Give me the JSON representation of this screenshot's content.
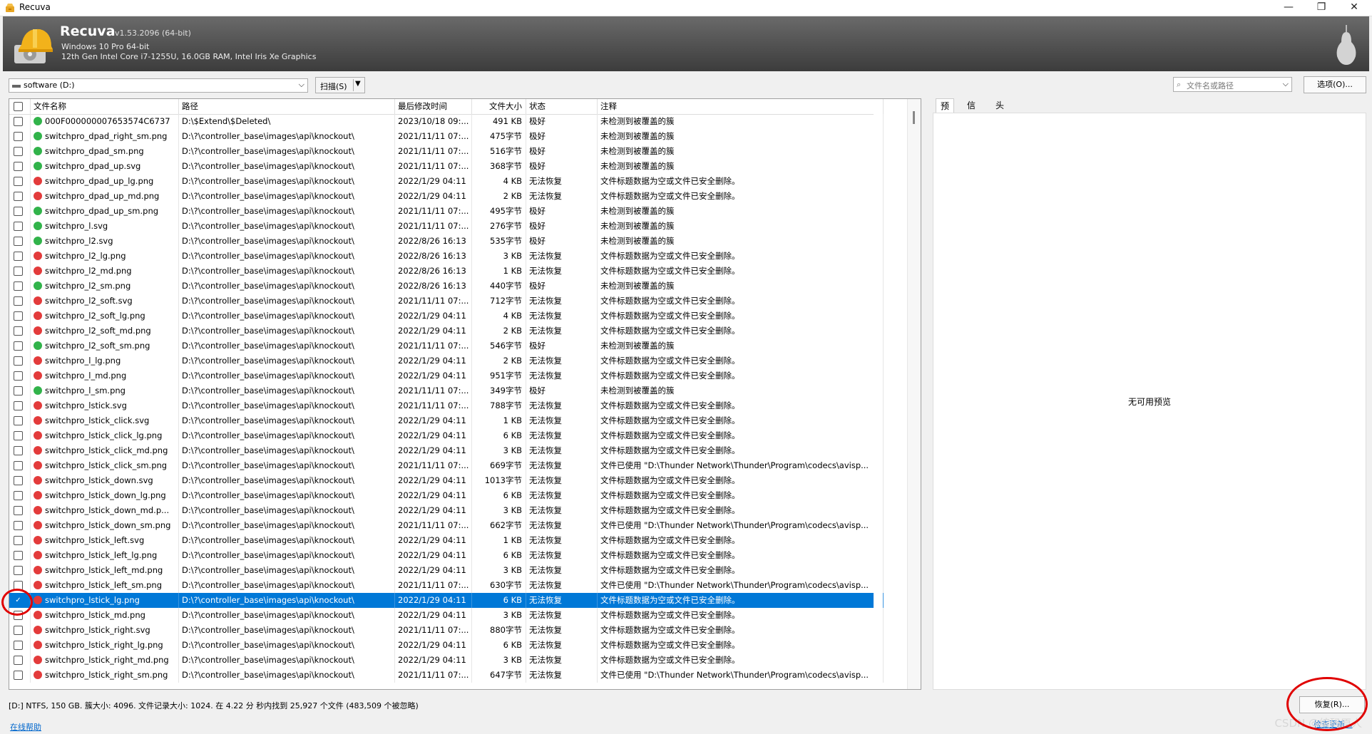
{
  "window": {
    "title": "Recuva",
    "buttons": [
      "—",
      "❐",
      "✕"
    ]
  },
  "header": {
    "app_name": "Recuva",
    "version": "v1.53.2096 (64-bit)",
    "os": "Windows 10 Pro 64-bit",
    "hardware": "12th Gen Intel Core i7-1255U, 16.0GB RAM, Intel Iris Xe Graphics"
  },
  "toolbar": {
    "drive": "software (D:)",
    "scan": "扫描(S)",
    "search_placeholder": "文件名或路径",
    "options": "选项(O)..."
  },
  "colors": {
    "good": "#31b34a",
    "bad": "#e33b3b",
    "selected": "#0078d7",
    "annotation": "#e00000"
  },
  "columns": [
    "文件名称",
    "路径",
    "最后修改时间",
    "文件大小",
    "状态",
    "注释"
  ],
  "rows": [
    {
      "name": "000F000000007653574C6737",
      "path": "D:\\$Extend\\$Deleted\\",
      "mtime": "2023/10/18 09:...",
      "size": "491 KB",
      "state": "极好",
      "note": "未检测到被覆盖的簇",
      "ok": true,
      "checked": false
    },
    {
      "name": "switchpro_dpad_right_sm.png",
      "path": "D:\\?\\controller_base\\images\\api\\knockout\\",
      "mtime": "2021/11/11 07:...",
      "size": "475字节",
      "state": "极好",
      "note": "未检测到被覆盖的簇",
      "ok": true,
      "checked": false
    },
    {
      "name": "switchpro_dpad_sm.png",
      "path": "D:\\?\\controller_base\\images\\api\\knockout\\",
      "mtime": "2021/11/11 07:...",
      "size": "516字节",
      "state": "极好",
      "note": "未检测到被覆盖的簇",
      "ok": true,
      "checked": false
    },
    {
      "name": "switchpro_dpad_up.svg",
      "path": "D:\\?\\controller_base\\images\\api\\knockout\\",
      "mtime": "2021/11/11 07:...",
      "size": "368字节",
      "state": "极好",
      "note": "未检测到被覆盖的簇",
      "ok": true,
      "checked": false
    },
    {
      "name": "switchpro_dpad_up_lg.png",
      "path": "D:\\?\\controller_base\\images\\api\\knockout\\",
      "mtime": "2022/1/29 04:11",
      "size": "4 KB",
      "state": "无法恢复",
      "note": "文件标题数据为空或文件已安全删除。",
      "ok": false,
      "checked": false
    },
    {
      "name": "switchpro_dpad_up_md.png",
      "path": "D:\\?\\controller_base\\images\\api\\knockout\\",
      "mtime": "2022/1/29 04:11",
      "size": "2 KB",
      "state": "无法恢复",
      "note": "文件标题数据为空或文件已安全删除。",
      "ok": false,
      "checked": false
    },
    {
      "name": "switchpro_dpad_up_sm.png",
      "path": "D:\\?\\controller_base\\images\\api\\knockout\\",
      "mtime": "2021/11/11 07:...",
      "size": "495字节",
      "state": "极好",
      "note": "未检测到被覆盖的簇",
      "ok": true,
      "checked": false
    },
    {
      "name": "switchpro_l.svg",
      "path": "D:\\?\\controller_base\\images\\api\\knockout\\",
      "mtime": "2021/11/11 07:...",
      "size": "276字节",
      "state": "极好",
      "note": "未检测到被覆盖的簇",
      "ok": true,
      "checked": false
    },
    {
      "name": "switchpro_l2.svg",
      "path": "D:\\?\\controller_base\\images\\api\\knockout\\",
      "mtime": "2022/8/26 16:13",
      "size": "535字节",
      "state": "极好",
      "note": "未检测到被覆盖的簇",
      "ok": true,
      "checked": false
    },
    {
      "name": "switchpro_l2_lg.png",
      "path": "D:\\?\\controller_base\\images\\api\\knockout\\",
      "mtime": "2022/8/26 16:13",
      "size": "3 KB",
      "state": "无法恢复",
      "note": "文件标题数据为空或文件已安全删除。",
      "ok": false,
      "checked": false
    },
    {
      "name": "switchpro_l2_md.png",
      "path": "D:\\?\\controller_base\\images\\api\\knockout\\",
      "mtime": "2022/8/26 16:13",
      "size": "1 KB",
      "state": "无法恢复",
      "note": "文件标题数据为空或文件已安全删除。",
      "ok": false,
      "checked": false
    },
    {
      "name": "switchpro_l2_sm.png",
      "path": "D:\\?\\controller_base\\images\\api\\knockout\\",
      "mtime": "2022/8/26 16:13",
      "size": "440字节",
      "state": "极好",
      "note": "未检测到被覆盖的簇",
      "ok": true,
      "checked": false
    },
    {
      "name": "switchpro_l2_soft.svg",
      "path": "D:\\?\\controller_base\\images\\api\\knockout\\",
      "mtime": "2021/11/11 07:...",
      "size": "712字节",
      "state": "无法恢复",
      "note": "文件标题数据为空或文件已安全删除。",
      "ok": false,
      "checked": false
    },
    {
      "name": "switchpro_l2_soft_lg.png",
      "path": "D:\\?\\controller_base\\images\\api\\knockout\\",
      "mtime": "2022/1/29 04:11",
      "size": "4 KB",
      "state": "无法恢复",
      "note": "文件标题数据为空或文件已安全删除。",
      "ok": false,
      "checked": false
    },
    {
      "name": "switchpro_l2_soft_md.png",
      "path": "D:\\?\\controller_base\\images\\api\\knockout\\",
      "mtime": "2022/1/29 04:11",
      "size": "2 KB",
      "state": "无法恢复",
      "note": "文件标题数据为空或文件已安全删除。",
      "ok": false,
      "checked": false
    },
    {
      "name": "switchpro_l2_soft_sm.png",
      "path": "D:\\?\\controller_base\\images\\api\\knockout\\",
      "mtime": "2021/11/11 07:...",
      "size": "546字节",
      "state": "极好",
      "note": "未检测到被覆盖的簇",
      "ok": true,
      "checked": false
    },
    {
      "name": "switchpro_l_lg.png",
      "path": "D:\\?\\controller_base\\images\\api\\knockout\\",
      "mtime": "2022/1/29 04:11",
      "size": "2 KB",
      "state": "无法恢复",
      "note": "文件标题数据为空或文件已安全删除。",
      "ok": false,
      "checked": false
    },
    {
      "name": "switchpro_l_md.png",
      "path": "D:\\?\\controller_base\\images\\api\\knockout\\",
      "mtime": "2022/1/29 04:11",
      "size": "951字节",
      "state": "无法恢复",
      "note": "文件标题数据为空或文件已安全删除。",
      "ok": false,
      "checked": false
    },
    {
      "name": "switchpro_l_sm.png",
      "path": "D:\\?\\controller_base\\images\\api\\knockout\\",
      "mtime": "2021/11/11 07:...",
      "size": "349字节",
      "state": "极好",
      "note": "未检测到被覆盖的簇",
      "ok": true,
      "checked": false
    },
    {
      "name": "switchpro_lstick.svg",
      "path": "D:\\?\\controller_base\\images\\api\\knockout\\",
      "mtime": "2021/11/11 07:...",
      "size": "788字节",
      "state": "无法恢复",
      "note": "文件标题数据为空或文件已安全删除。",
      "ok": false,
      "checked": false
    },
    {
      "name": "switchpro_lstick_click.svg",
      "path": "D:\\?\\controller_base\\images\\api\\knockout\\",
      "mtime": "2022/1/29 04:11",
      "size": "1 KB",
      "state": "无法恢复",
      "note": "文件标题数据为空或文件已安全删除。",
      "ok": false,
      "checked": false
    },
    {
      "name": "switchpro_lstick_click_lg.png",
      "path": "D:\\?\\controller_base\\images\\api\\knockout\\",
      "mtime": "2022/1/29 04:11",
      "size": "6 KB",
      "state": "无法恢复",
      "note": "文件标题数据为空或文件已安全删除。",
      "ok": false,
      "checked": false
    },
    {
      "name": "switchpro_lstick_click_md.png",
      "path": "D:\\?\\controller_base\\images\\api\\knockout\\",
      "mtime": "2022/1/29 04:11",
      "size": "3 KB",
      "state": "无法恢复",
      "note": "文件标题数据为空或文件已安全删除。",
      "ok": false,
      "checked": false
    },
    {
      "name": "switchpro_lstick_click_sm.png",
      "path": "D:\\?\\controller_base\\images\\api\\knockout\\",
      "mtime": "2021/11/11 07:...",
      "size": "669字节",
      "state": "无法恢复",
      "note": "文件已使用 \"D:\\Thunder Network\\Thunder\\Program\\codecs\\avisp...",
      "ok": false,
      "checked": false
    },
    {
      "name": "switchpro_lstick_down.svg",
      "path": "D:\\?\\controller_base\\images\\api\\knockout\\",
      "mtime": "2022/1/29 04:11",
      "size": "1013字节",
      "state": "无法恢复",
      "note": "文件标题数据为空或文件已安全删除。",
      "ok": false,
      "checked": false
    },
    {
      "name": "switchpro_lstick_down_lg.png",
      "path": "D:\\?\\controller_base\\images\\api\\knockout\\",
      "mtime": "2022/1/29 04:11",
      "size": "6 KB",
      "state": "无法恢复",
      "note": "文件标题数据为空或文件已安全删除。",
      "ok": false,
      "checked": false
    },
    {
      "name": "switchpro_lstick_down_md.p...",
      "path": "D:\\?\\controller_base\\images\\api\\knockout\\",
      "mtime": "2022/1/29 04:11",
      "size": "3 KB",
      "state": "无法恢复",
      "note": "文件标题数据为空或文件已安全删除。",
      "ok": false,
      "checked": false
    },
    {
      "name": "switchpro_lstick_down_sm.png",
      "path": "D:\\?\\controller_base\\images\\api\\knockout\\",
      "mtime": "2021/11/11 07:...",
      "size": "662字节",
      "state": "无法恢复",
      "note": "文件已使用 \"D:\\Thunder Network\\Thunder\\Program\\codecs\\avisp...",
      "ok": false,
      "checked": false
    },
    {
      "name": "switchpro_lstick_left.svg",
      "path": "D:\\?\\controller_base\\images\\api\\knockout\\",
      "mtime": "2022/1/29 04:11",
      "size": "1 KB",
      "state": "无法恢复",
      "note": "文件标题数据为空或文件已安全删除。",
      "ok": false,
      "checked": false
    },
    {
      "name": "switchpro_lstick_left_lg.png",
      "path": "D:\\?\\controller_base\\images\\api\\knockout\\",
      "mtime": "2022/1/29 04:11",
      "size": "6 KB",
      "state": "无法恢复",
      "note": "文件标题数据为空或文件已安全删除。",
      "ok": false,
      "checked": false
    },
    {
      "name": "switchpro_lstick_left_md.png",
      "path": "D:\\?\\controller_base\\images\\api\\knockout\\",
      "mtime": "2022/1/29 04:11",
      "size": "3 KB",
      "state": "无法恢复",
      "note": "文件标题数据为空或文件已安全删除。",
      "ok": false,
      "checked": false
    },
    {
      "name": "switchpro_lstick_left_sm.png",
      "path": "D:\\?\\controller_base\\images\\api\\knockout\\",
      "mtime": "2021/11/11 07:...",
      "size": "630字节",
      "state": "无法恢复",
      "note": "文件已使用 \"D:\\Thunder Network\\Thunder\\Program\\codecs\\avisp...",
      "ok": false,
      "checked": false
    },
    {
      "name": "switchpro_lstick_lg.png",
      "path": "D:\\?\\controller_base\\images\\api\\knockout\\",
      "mtime": "2022/1/29 04:11",
      "size": "6 KB",
      "state": "无法恢复",
      "note": "文件标题数据为空或文件已安全删除。",
      "ok": false,
      "checked": true,
      "selected": true
    },
    {
      "name": "switchpro_lstick_md.png",
      "path": "D:\\?\\controller_base\\images\\api\\knockout\\",
      "mtime": "2022/1/29 04:11",
      "size": "3 KB",
      "state": "无法恢复",
      "note": "文件标题数据为空或文件已安全删除。",
      "ok": false,
      "checked": false
    },
    {
      "name": "switchpro_lstick_right.svg",
      "path": "D:\\?\\controller_base\\images\\api\\knockout\\",
      "mtime": "2021/11/11 07:...",
      "size": "880字节",
      "state": "无法恢复",
      "note": "文件标题数据为空或文件已安全删除。",
      "ok": false,
      "checked": false
    },
    {
      "name": "switchpro_lstick_right_lg.png",
      "path": "D:\\?\\controller_base\\images\\api\\knockout\\",
      "mtime": "2022/1/29 04:11",
      "size": "6 KB",
      "state": "无法恢复",
      "note": "文件标题数据为空或文件已安全删除。",
      "ok": false,
      "checked": false
    },
    {
      "name": "switchpro_lstick_right_md.png",
      "path": "D:\\?\\controller_base\\images\\api\\knockout\\",
      "mtime": "2022/1/29 04:11",
      "size": "3 KB",
      "state": "无法恢复",
      "note": "文件标题数据为空或文件已安全删除。",
      "ok": false,
      "checked": false
    },
    {
      "name": "switchpro_lstick_right_sm.png",
      "path": "D:\\?\\controller_base\\images\\api\\knockout\\",
      "mtime": "2021/11/11 07:...",
      "size": "647字节",
      "state": "无法恢复",
      "note": "文件已使用 \"D:\\Thunder Network\\Thunder\\Program\\codecs\\avisp...",
      "ok": false,
      "checked": false
    }
  ],
  "preview": {
    "tabs": [
      "预览",
      "信息",
      "头"
    ],
    "empty_message": "无可用预览"
  },
  "status": "[D:] NTFS, 150 GB. 簇大小: 4096. 文件记录大小: 1024. 在 4.22 分 秒内找到 25,927 个文件 (483,509 个被忽略)",
  "footer": {
    "help": "在线帮助",
    "recover": "恢复(R)...",
    "update": "检查更新...",
    "watermark": "CSDN @编码原人"
  }
}
